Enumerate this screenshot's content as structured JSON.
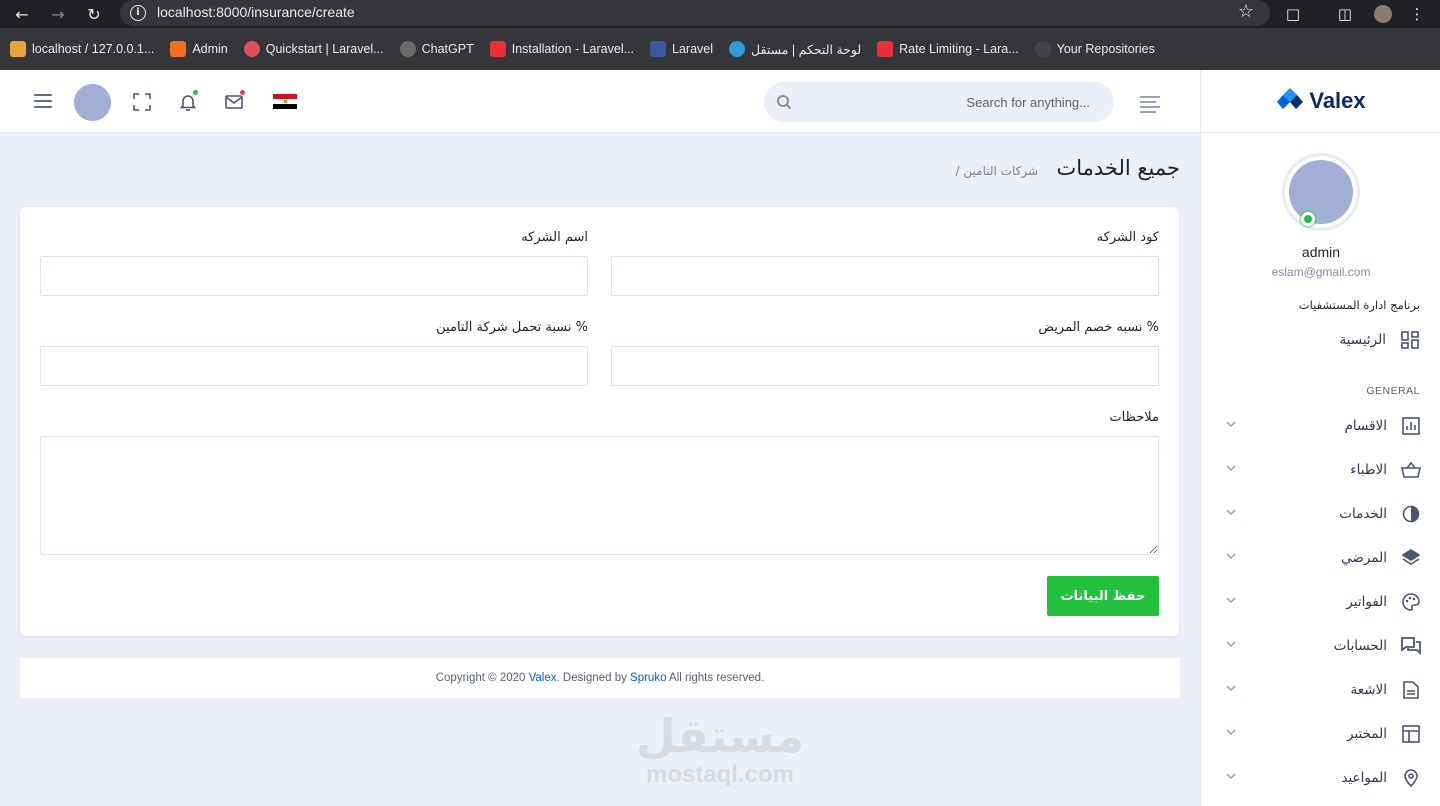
{
  "browser": {
    "url": "localhost:8000/insurance/create",
    "bookmarks": [
      {
        "label": "localhost / 127.0.0.1...",
        "color": "#e8a53c"
      },
      {
        "label": "Admin",
        "color": "#f36f21"
      },
      {
        "label": "Quickstart | Laravel...",
        "color": "#e04e5a"
      },
      {
        "label": "ChatGPT",
        "color": "#6b6b6b"
      },
      {
        "label": "Installation - Laravel...",
        "color": "#e8303a"
      },
      {
        "label": "Laravel",
        "color": "#3b5a9b"
      },
      {
        "label": "لوحة التحكم | مستقل",
        "color": "#2d9cdb"
      },
      {
        "label": "Rate Limiting - Lara...",
        "color": "#e8303a"
      },
      {
        "label": "Your Repositories",
        "color": "#444"
      }
    ]
  },
  "topbar": {
    "search_placeholder": "Search for anything...",
    "notification_dot_color": "#22c03c",
    "mail_dot_color": "#ee335e"
  },
  "sidebar": {
    "logo_text": "Valex",
    "user_name": "admin",
    "user_email": "eslam@gmail.com",
    "program_label": "برنامج ادارة المستشفيات",
    "home_label": "الرئيسية",
    "section_label": "GENERAL",
    "items": [
      {
        "label": "الاقسام",
        "icon": "bar-chart-icon"
      },
      {
        "label": "الاطباء",
        "icon": "basket-icon"
      },
      {
        "label": "الخدمات",
        "icon": "pie-icon"
      },
      {
        "label": "المرضي",
        "icon": "layers-icon"
      },
      {
        "label": "الفواتير",
        "icon": "palette-icon"
      },
      {
        "label": "الحسابات",
        "icon": "chat-icon"
      },
      {
        "label": "الاشعة",
        "icon": "document-icon"
      },
      {
        "label": "المختبر",
        "icon": "table-icon"
      },
      {
        "label": "المواعيد",
        "icon": "location-icon"
      }
    ]
  },
  "main": {
    "title": "جميع الخدمات",
    "breadcrumb": "/ شركات التامين",
    "form": {
      "company_code_label": "كود الشركه",
      "company_name_label": "اسم الشركه",
      "patient_discount_label": "نسبه خصم المريض %",
      "insurance_share_label": "نسبة تحمل شركة التامين %",
      "notes_label": "ملاحظات",
      "save_label": "حفظ البيانات"
    }
  },
  "footer": {
    "prefix": "Copyright © 2020 ",
    "brand": "Valex",
    "middle": ". Designed by ",
    "designer": "Spruko",
    "suffix": " All rights reserved."
  },
  "watermark": {
    "arabic": "مستقل",
    "latin": "mostaql.com"
  },
  "colors": {
    "primary": "#0162e8",
    "success": "#22c03c",
    "page_bg": "#eceff8"
  }
}
